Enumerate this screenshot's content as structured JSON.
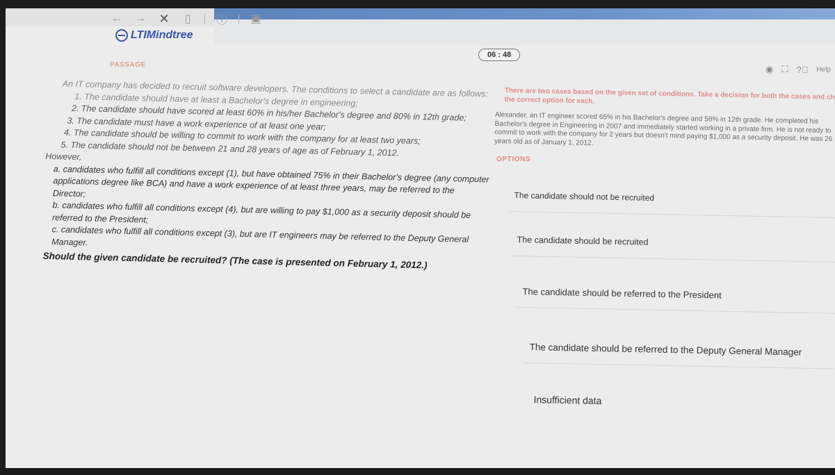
{
  "toolbar": {
    "back_icon": "back-arrow-icon",
    "forward_icon": "forward-arrow-icon",
    "close_label": "✕",
    "info_icon": "info-icon",
    "doc_icon": "document-icon"
  },
  "header": {
    "logo_text": "LTIMindtree"
  },
  "timer": "06 : 48",
  "right_icons": {
    "help_label": "Help"
  },
  "passage": {
    "label": "PASSAGE",
    "intro": "An IT company has decided to recruit software developers. The conditions to select a candidate are as follows:",
    "conditions": [
      "1. The candidate should have at least a Bachelor's degree in engineering;",
      "2. The candidate should have scored at least 60% in his/her Bachelor's degree and 80% in 12th grade;",
      "3. The candidate must have a work experience of at least one year;",
      "4. The candidate should be willing to commit to work with the company for at least two years;",
      "5. The candidate should not be between 21 and 28 years of age as of February 1, 2012."
    ],
    "however": "However,",
    "exceptions": [
      "a. candidates who fulfill all conditions except (1), but have obtained 75% in their Bachelor's degree (any computer applications degree like BCA) and have a work experience of at least three years, may be referred to the Director;",
      "b. candidates who fulfill all conditions except (4), but are willing to pay $1,000 as a security deposit should be referred to the President;",
      "c. candidates who fulfill all conditions except (3), but are IT engineers may be referred to the Deputy General Manager."
    ],
    "question": "Should the given candidate be recruited? (The case is presented on February 1, 2012.)"
  },
  "case": {
    "intro": "There are two cases based on the given set of conditions. Take a decision for both the cases and choose the correct option for each.",
    "text": "Alexander, an IT engineer scored 65% in his Bachelor's degree and 58% in 12th grade. He completed his Bachelor's degree in Engineering in 2007 and immediately started working in a private firm. He is not ready to commit to work with the company for 2 years but doesn't mind paying $1,000 as a security deposit. He was 26 years old as of January 1, 2012."
  },
  "options": {
    "label": "OPTIONS",
    "items": [
      "The candidate should not be recruited",
      "The candidate should be recruited",
      "The candidate should be referred to the President",
      "The candidate should be referred to the Deputy General Manager",
      "Insufficient data"
    ]
  }
}
